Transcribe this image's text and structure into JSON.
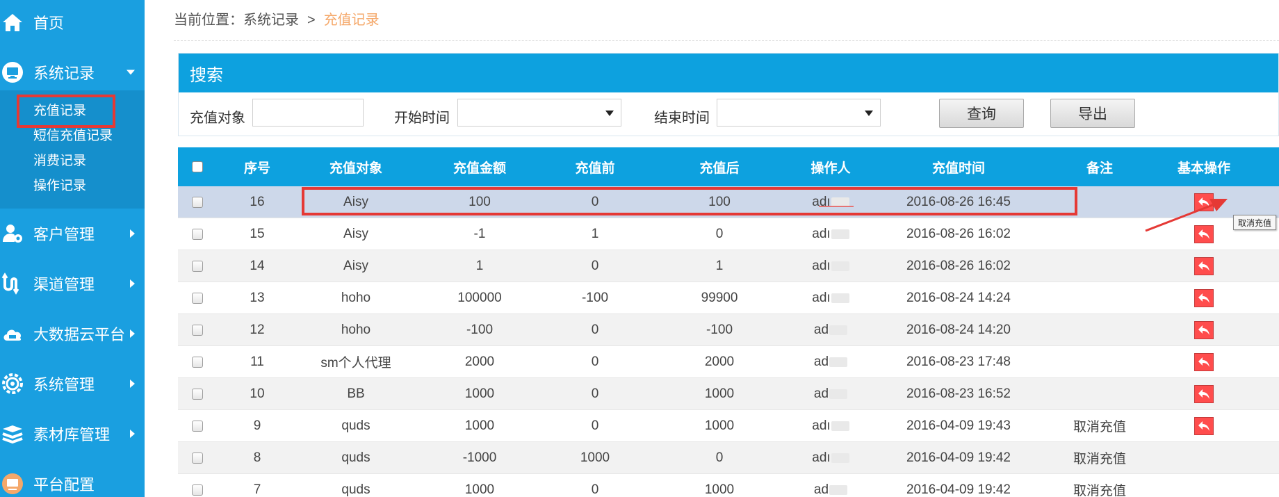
{
  "sidebar": {
    "items": [
      {
        "label": "首页",
        "icon": "home-icon"
      },
      {
        "label": "系统记录",
        "icon": "monitor-icon"
      },
      {
        "label": "客户管理",
        "icon": "user-gear-icon"
      },
      {
        "label": "渠道管理",
        "icon": "channel-icon"
      },
      {
        "label": "大数据云平台",
        "icon": "cloud-icon"
      },
      {
        "label": "系统管理",
        "icon": "gear-icon"
      },
      {
        "label": "素材库管理",
        "icon": "layers-icon"
      },
      {
        "label": "平台配置",
        "icon": "monitor-icon"
      }
    ],
    "subitems": [
      "充值记录",
      "短信充值记录",
      "消费记录",
      "操作记录"
    ]
  },
  "breadcrumb": {
    "prefix": "当前位置：系统记录",
    "separator": ">",
    "current": "充值记录"
  },
  "search": {
    "title": "搜索",
    "target_label": "充值对象",
    "target_value": "",
    "start_label": "开始时间",
    "end_label": "结束时间",
    "query_button": "查询",
    "export_button": "导出"
  },
  "table": {
    "columns": [
      "序号",
      "充值对象",
      "充值金额",
      "充值前",
      "充值后",
      "操作人",
      "充值时间",
      "备注",
      "基本操作"
    ],
    "rows": [
      {
        "id": "16",
        "target": "Aisy",
        "amount": "100",
        "before": "0",
        "after": "100",
        "operator": "adı",
        "time": "2016-08-26 16:45",
        "note": "",
        "action": true
      },
      {
        "id": "15",
        "target": "Aisy",
        "amount": "-1",
        "before": "1",
        "after": "0",
        "operator": "adı",
        "time": "2016-08-26 16:02",
        "note": "",
        "action": true
      },
      {
        "id": "14",
        "target": "Aisy",
        "amount": "1",
        "before": "0",
        "after": "1",
        "operator": "adı",
        "time": "2016-08-26 16:02",
        "note": "",
        "action": true
      },
      {
        "id": "13",
        "target": "hoho",
        "amount": "100000",
        "before": "-100",
        "after": "99900",
        "operator": "adı",
        "time": "2016-08-24 14:24",
        "note": "",
        "action": true
      },
      {
        "id": "12",
        "target": "hoho",
        "amount": "-100",
        "before": "0",
        "after": "-100",
        "operator": "ad",
        "time": "2016-08-24 14:20",
        "note": "",
        "action": true
      },
      {
        "id": "11",
        "target": "sm个人代理",
        "amount": "2000",
        "before": "0",
        "after": "2000",
        "operator": "ad",
        "time": "2016-08-23 17:48",
        "note": "",
        "action": true
      },
      {
        "id": "10",
        "target": "BB",
        "amount": "1000",
        "before": "0",
        "after": "1000",
        "operator": "ad",
        "time": "2016-08-23 16:52",
        "note": "",
        "action": true
      },
      {
        "id": "9",
        "target": "quds",
        "amount": "1000",
        "before": "0",
        "after": "1000",
        "operator": "adı",
        "time": "2016-04-09 19:43",
        "note": "取消充值",
        "action": true
      },
      {
        "id": "8",
        "target": "quds",
        "amount": "-1000",
        "before": "1000",
        "after": "0",
        "operator": "adı",
        "time": "2016-04-09 19:42",
        "note": "取消充值",
        "action": false
      },
      {
        "id": "7",
        "target": "quds",
        "amount": "1000",
        "before": "0",
        "after": "1000",
        "operator": "ad",
        "time": "2016-04-09 19:42",
        "note": "取消充值",
        "action": false
      }
    ]
  },
  "tooltip": "取消充值",
  "colors": {
    "sidebar": "#1a9fe0",
    "header": "#0da1df",
    "highlight": "#e53935",
    "action": "#ff4d4d",
    "current_crumb": "#f5a86a"
  }
}
